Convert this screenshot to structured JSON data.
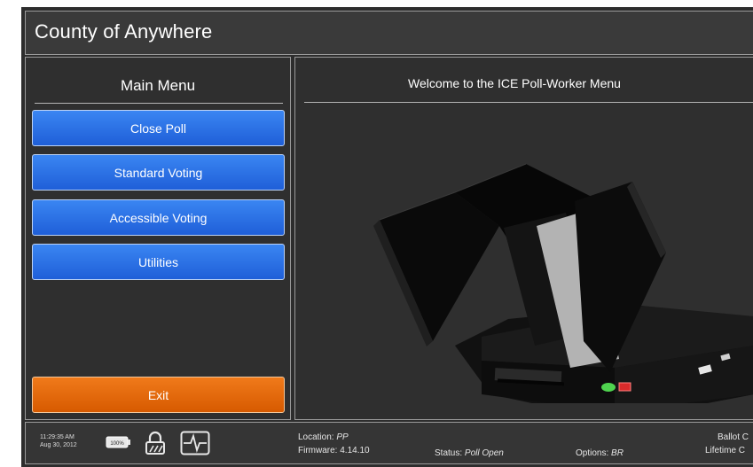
{
  "header": {
    "title": "County of Anywhere"
  },
  "menu": {
    "title": "Main Menu",
    "buttons": {
      "close_poll": "Close Poll",
      "standard_voting": "Standard Voting",
      "accessible_voting": "Accessible Voting",
      "utilities": "Utilities",
      "exit": "Exit"
    },
    "colors": {
      "primary_button": "#2a72e6",
      "exit_button": "#e56a0c"
    }
  },
  "content": {
    "welcome": "Welcome to the ICE Poll-Worker Menu",
    "image": "voting-machine-image"
  },
  "status": {
    "time": "11:29:35 AM",
    "date": "Aug 30, 2012",
    "battery": "100%",
    "location_label": "Location:",
    "location_value": "PP",
    "firmware_label": "Firmware:",
    "firmware_value": "4.14.10",
    "status_label": "Status:",
    "status_value": "Poll Open",
    "options_label": "Options:",
    "options_value": "BR",
    "ballot_label": "Ballot C",
    "lifetime_label": "Lifetime C",
    "icons": [
      "battery-icon",
      "lock-icon",
      "heartbeat-icon"
    ]
  }
}
